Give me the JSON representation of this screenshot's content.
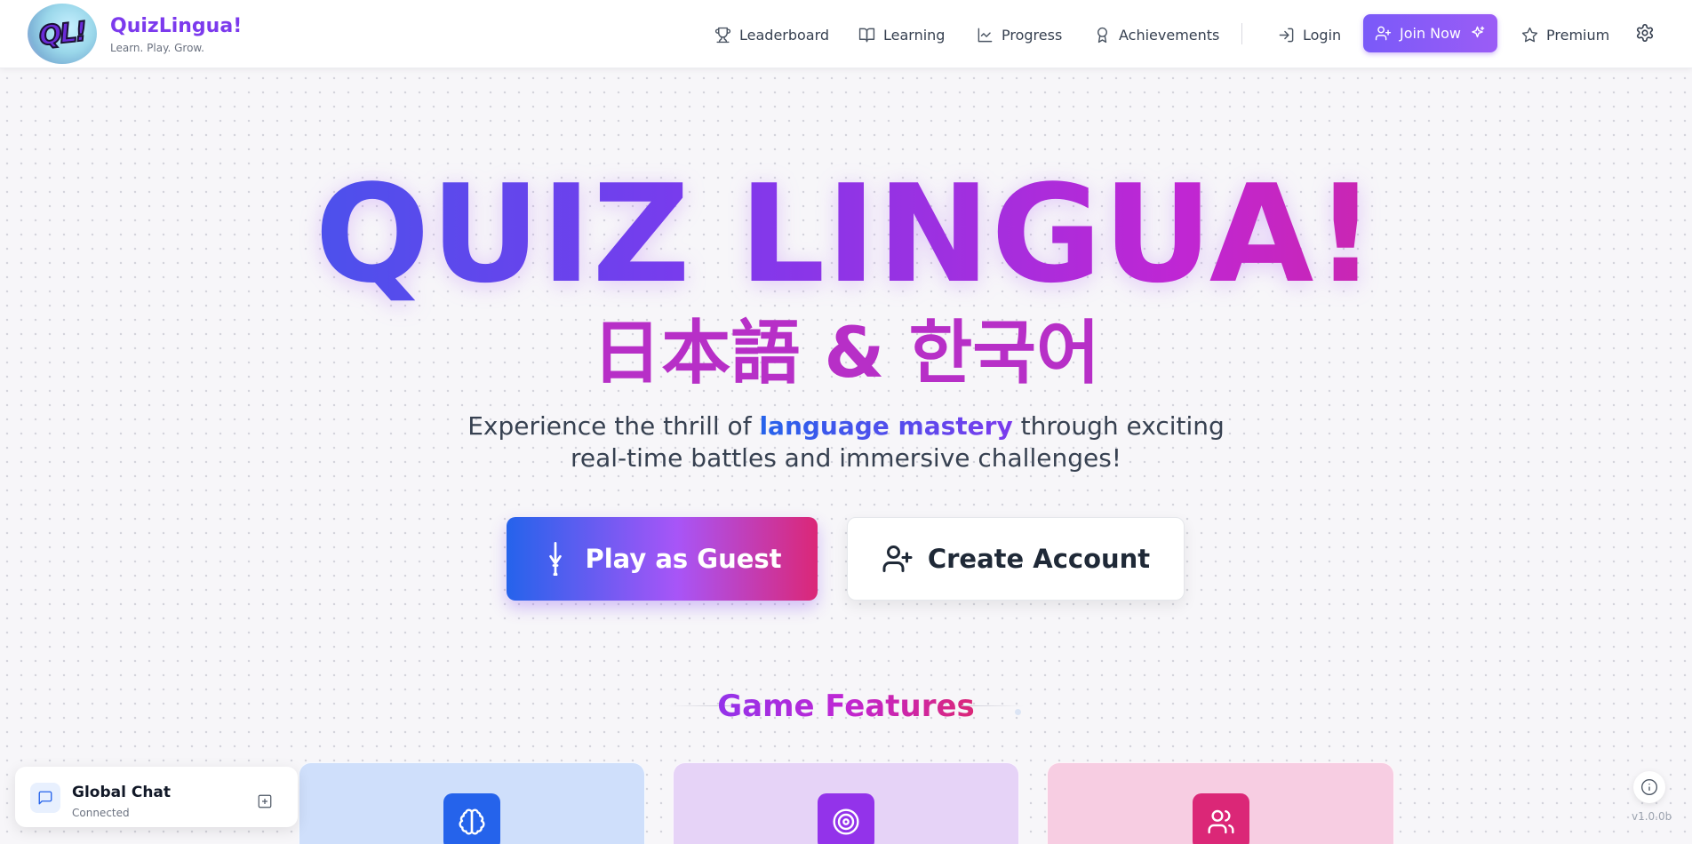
{
  "brand": {
    "logo_text": "QL!",
    "name": "QuizLingua!",
    "tagline": "Learn. Play. Grow."
  },
  "nav": {
    "items": [
      {
        "label": "Leaderboard",
        "icon": "trophy-icon"
      },
      {
        "label": "Learning",
        "icon": "book-open-icon"
      },
      {
        "label": "Progress",
        "icon": "line-chart-icon"
      },
      {
        "label": "Achievements",
        "icon": "award-icon"
      }
    ],
    "login_label": "Login",
    "join_label": "Join Now",
    "premium_label": "Premium"
  },
  "hero": {
    "title": "QUIZ LINGUA!",
    "subtitle": "日本語 & 한국어",
    "desc_before": "Experience the thrill of ",
    "desc_highlight": "language mastery",
    "desc_after": " through exciting real-time battles and immersive challenges!",
    "play_guest_label": "Play as Guest",
    "create_account_label": "Create Account"
  },
  "features": {
    "heading": "Game Features",
    "cards": [
      {
        "icon": "brain-icon",
        "bg": "#cfdffb",
        "icon_bg": "#2563eb"
      },
      {
        "icon": "target-icon",
        "bg": "#e6d3f7",
        "icon_bg": "#9333ea"
      },
      {
        "icon": "users-icon",
        "bg": "#f7cde2",
        "icon_bg": "#db2777"
      }
    ]
  },
  "chat": {
    "title": "Global Chat",
    "status": "Connected"
  },
  "footer": {
    "version": "v1.0.0b"
  },
  "colors": {
    "brand_purple": "#7c3aed",
    "gradient_start": "#2563eb",
    "gradient_end": "#db2777"
  }
}
